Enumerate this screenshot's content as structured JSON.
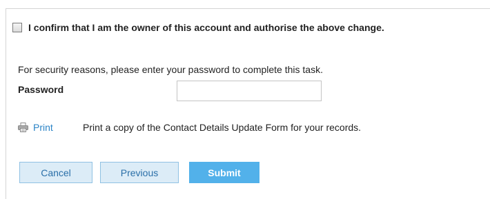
{
  "confirmation": {
    "checked": false,
    "label": "I confirm that I am the owner of this account and authorise the above change."
  },
  "security": {
    "instruction": "For security reasons, please enter your password to complete this task.",
    "password_label": "Password",
    "password_value": "",
    "password_placeholder": ""
  },
  "print": {
    "icon": "printer-icon",
    "link_label": "Print",
    "description": "Print a copy of the Contact Details Update Form for your records."
  },
  "buttons": {
    "cancel_label": "Cancel",
    "previous_label": "Previous",
    "submit_label": "Submit"
  },
  "colors": {
    "link": "#2a83c6",
    "secondary_button_bg": "#dcecf7",
    "secondary_button_border": "#8fc1e3",
    "primary_button_bg": "#52b1ea"
  }
}
